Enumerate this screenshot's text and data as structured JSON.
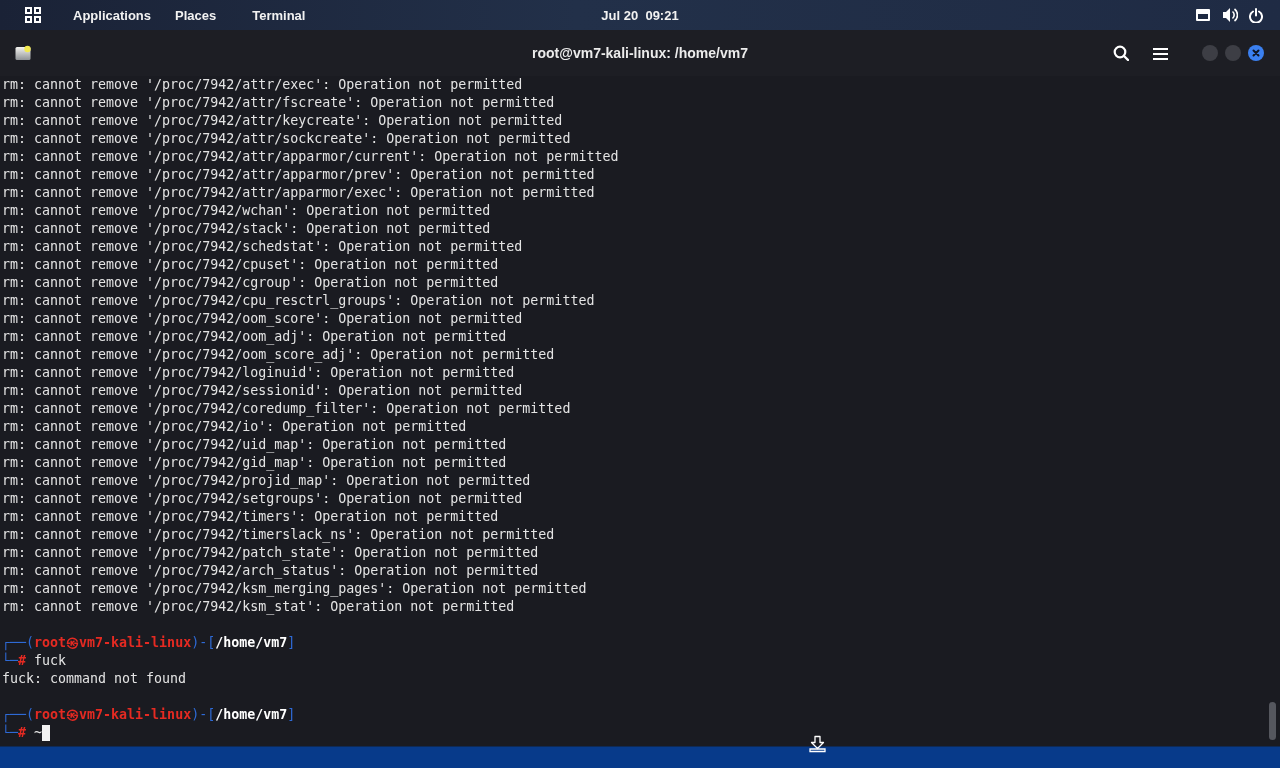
{
  "top_bar": {
    "menus": [
      "Applications",
      "Places"
    ],
    "app_menu": "Terminal",
    "clock": "Jul 20  09:21"
  },
  "window": {
    "title": "root@vm7-kali-linux: /home/vm7"
  },
  "terminal": {
    "lines": [
      {
        "kind": "output",
        "text": "rm: cannot remove '/proc/7942/attr/exec': Operation not permitted"
      },
      {
        "kind": "output",
        "text": "rm: cannot remove '/proc/7942/attr/fscreate': Operation not permitted"
      },
      {
        "kind": "output",
        "text": "rm: cannot remove '/proc/7942/attr/keycreate': Operation not permitted"
      },
      {
        "kind": "output",
        "text": "rm: cannot remove '/proc/7942/attr/sockcreate': Operation not permitted"
      },
      {
        "kind": "output",
        "text": "rm: cannot remove '/proc/7942/attr/apparmor/current': Operation not permitted"
      },
      {
        "kind": "output",
        "text": "rm: cannot remove '/proc/7942/attr/apparmor/prev': Operation not permitted"
      },
      {
        "kind": "output",
        "text": "rm: cannot remove '/proc/7942/attr/apparmor/exec': Operation not permitted"
      },
      {
        "kind": "output",
        "text": "rm: cannot remove '/proc/7942/wchan': Operation not permitted"
      },
      {
        "kind": "output",
        "text": "rm: cannot remove '/proc/7942/stack': Operation not permitted"
      },
      {
        "kind": "output",
        "text": "rm: cannot remove '/proc/7942/schedstat': Operation not permitted"
      },
      {
        "kind": "output",
        "text": "rm: cannot remove '/proc/7942/cpuset': Operation not permitted"
      },
      {
        "kind": "output",
        "text": "rm: cannot remove '/proc/7942/cgroup': Operation not permitted"
      },
      {
        "kind": "output",
        "text": "rm: cannot remove '/proc/7942/cpu_resctrl_groups': Operation not permitted"
      },
      {
        "kind": "output",
        "text": "rm: cannot remove '/proc/7942/oom_score': Operation not permitted"
      },
      {
        "kind": "output",
        "text": "rm: cannot remove '/proc/7942/oom_adj': Operation not permitted"
      },
      {
        "kind": "output",
        "text": "rm: cannot remove '/proc/7942/oom_score_adj': Operation not permitted"
      },
      {
        "kind": "output",
        "text": "rm: cannot remove '/proc/7942/loginuid': Operation not permitted"
      },
      {
        "kind": "output",
        "text": "rm: cannot remove '/proc/7942/sessionid': Operation not permitted"
      },
      {
        "kind": "output",
        "text": "rm: cannot remove '/proc/7942/coredump_filter': Operation not permitted"
      },
      {
        "kind": "output",
        "text": "rm: cannot remove '/proc/7942/io': Operation not permitted"
      },
      {
        "kind": "output",
        "text": "rm: cannot remove '/proc/7942/uid_map': Operation not permitted"
      },
      {
        "kind": "output",
        "text": "rm: cannot remove '/proc/7942/gid_map': Operation not permitted"
      },
      {
        "kind": "output",
        "text": "rm: cannot remove '/proc/7942/projid_map': Operation not permitted"
      },
      {
        "kind": "output",
        "text": "rm: cannot remove '/proc/7942/setgroups': Operation not permitted"
      },
      {
        "kind": "output",
        "text": "rm: cannot remove '/proc/7942/timers': Operation not permitted"
      },
      {
        "kind": "output",
        "text": "rm: cannot remove '/proc/7942/timerslack_ns': Operation not permitted"
      },
      {
        "kind": "output",
        "text": "rm: cannot remove '/proc/7942/patch_state': Operation not permitted"
      },
      {
        "kind": "output",
        "text": "rm: cannot remove '/proc/7942/arch_status': Operation not permitted"
      },
      {
        "kind": "output",
        "text": "rm: cannot remove '/proc/7942/ksm_merging_pages': Operation not permitted"
      },
      {
        "kind": "output",
        "text": "rm: cannot remove '/proc/7942/ksm_stat': Operation not permitted"
      },
      {
        "kind": "blank"
      },
      {
        "kind": "prompt",
        "frame_top": "┌──(",
        "user": "root",
        "at": "㉿",
        "host": "vm7-kali-linux",
        "bracket": ")-[",
        "path": "/home/vm7",
        "bracket_end": "]",
        "frame_bottom": "└─",
        "symbol": "#",
        "command": "fuck",
        "cursor": false
      },
      {
        "kind": "output",
        "text": "fuck: command not found"
      },
      {
        "kind": "blank"
      },
      {
        "kind": "prompt",
        "frame_top": "┌──(",
        "user": "root",
        "at": "㉿",
        "host": "vm7-kali-linux",
        "bracket": ")-[",
        "path": "/home/vm7",
        "bracket_end": "]",
        "frame_bottom": "└─",
        "symbol": "#",
        "command": "~",
        "cursor": true
      }
    ]
  }
}
